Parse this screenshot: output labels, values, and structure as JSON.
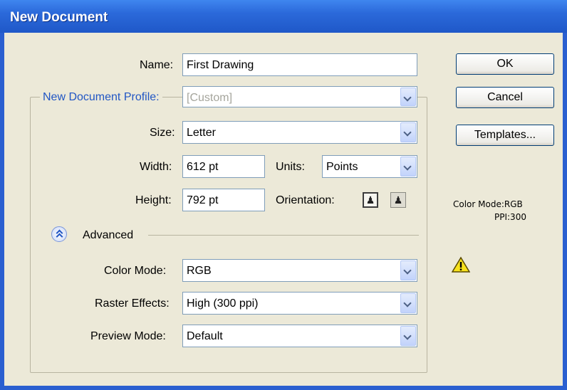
{
  "window": {
    "title": "New Document"
  },
  "form": {
    "name_label": "Name:",
    "name_value": "First Drawing",
    "profile_label": "New Document Profile:",
    "profile_value": "[Custom]",
    "size_label": "Size:",
    "size_value": "Letter",
    "width_label": "Width:",
    "width_value": "612 pt",
    "units_label": "Units:",
    "units_value": "Points",
    "height_label": "Height:",
    "height_value": "792 pt",
    "orientation_label": "Orientation:",
    "orientation_selected": "portrait",
    "advanced_label": "Advanced",
    "color_mode_label": "Color Mode:",
    "color_mode_value": "RGB",
    "raster_label": "Raster Effects:",
    "raster_value": "High (300 ppi)",
    "preview_label": "Preview Mode:",
    "preview_value": "Default"
  },
  "buttons": {
    "ok": "OK",
    "cancel": "Cancel",
    "templates": "Templates..."
  },
  "info": {
    "color_mode": "Color Mode:RGB",
    "ppi": "PPI:300",
    "warning_icon": "warning-icon"
  },
  "colors": {
    "titlebar": "#2b69da",
    "profile_label": "#2156c4",
    "dialog_bg": "#ece9d8"
  }
}
